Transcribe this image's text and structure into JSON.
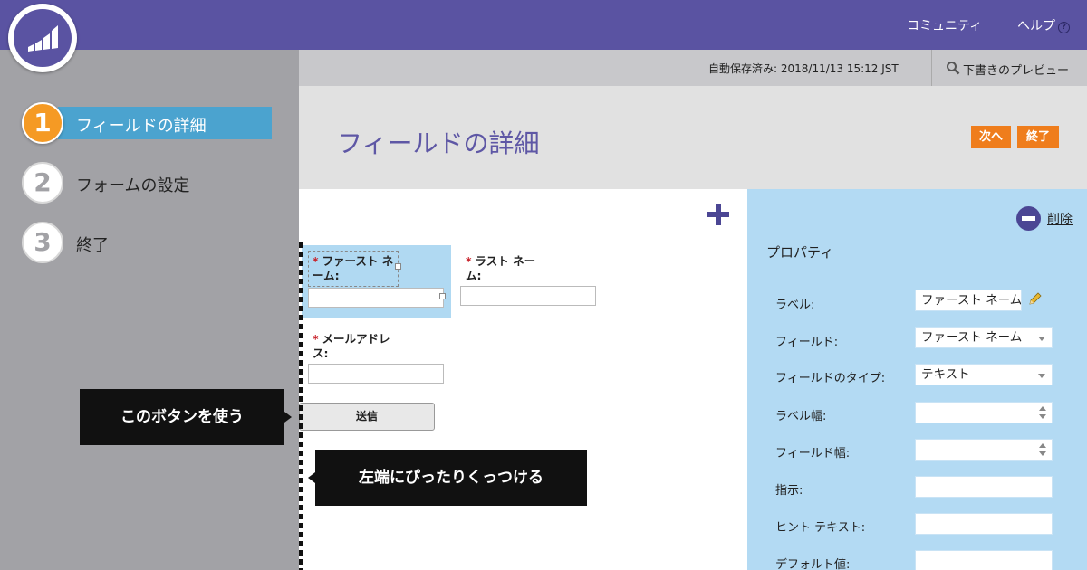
{
  "topbar": {
    "community_label": "コミュニティ",
    "help_label": "ヘルプ",
    "help_icon": "?"
  },
  "sidebar": {
    "steps": [
      {
        "number": "1",
        "label": "フィールドの詳細",
        "active": true
      },
      {
        "number": "2",
        "label": "フォームの設定",
        "active": false
      },
      {
        "number": "3",
        "label": "終了",
        "active": false
      }
    ]
  },
  "header": {
    "autosave": "自動保存済み: 2018/11/13 15:12 JST",
    "preview_label": "下書きのプレビュー",
    "page_title": "フィールドの詳細",
    "next_button": "次へ",
    "finish_button": "終了"
  },
  "form": {
    "fields": [
      {
        "label_line1": "ファースト ネ",
        "label_line2": "ーム:",
        "required": "*",
        "value": ""
      },
      {
        "label_line1": "ラスト ネー",
        "label_line2": "ム:",
        "required": "*",
        "value": ""
      },
      {
        "label_line1": "メールアドレ",
        "label_line2": "ス:",
        "required": "*",
        "value": ""
      }
    ],
    "submit_label": "送信"
  },
  "callouts": {
    "use_button": "このボタンを使う",
    "stick_left": "左端にぴったりくっつける"
  },
  "properties": {
    "delete_label": "削除",
    "title": "プロパティ",
    "rows": [
      {
        "label": "ラベル:",
        "value": "ファースト ネーム"
      },
      {
        "label": "フィールド:",
        "value": "ファースト ネーム"
      },
      {
        "label": "フィールドのタイプ:",
        "value": "テキスト"
      },
      {
        "label": "ラベル幅:",
        "value": ""
      },
      {
        "label": "フィールド幅:",
        "value": ""
      },
      {
        "label": "指示:",
        "value": ""
      },
      {
        "label": "ヒント テキスト:",
        "value": ""
      },
      {
        "label": "デフォルト値:",
        "value": ""
      }
    ]
  },
  "colors": {
    "brand_purple": "#5a53a2",
    "accent_orange": "#ef7d1c",
    "step_blue": "#4ba3cf",
    "panel_blue": "#b3daf3"
  }
}
